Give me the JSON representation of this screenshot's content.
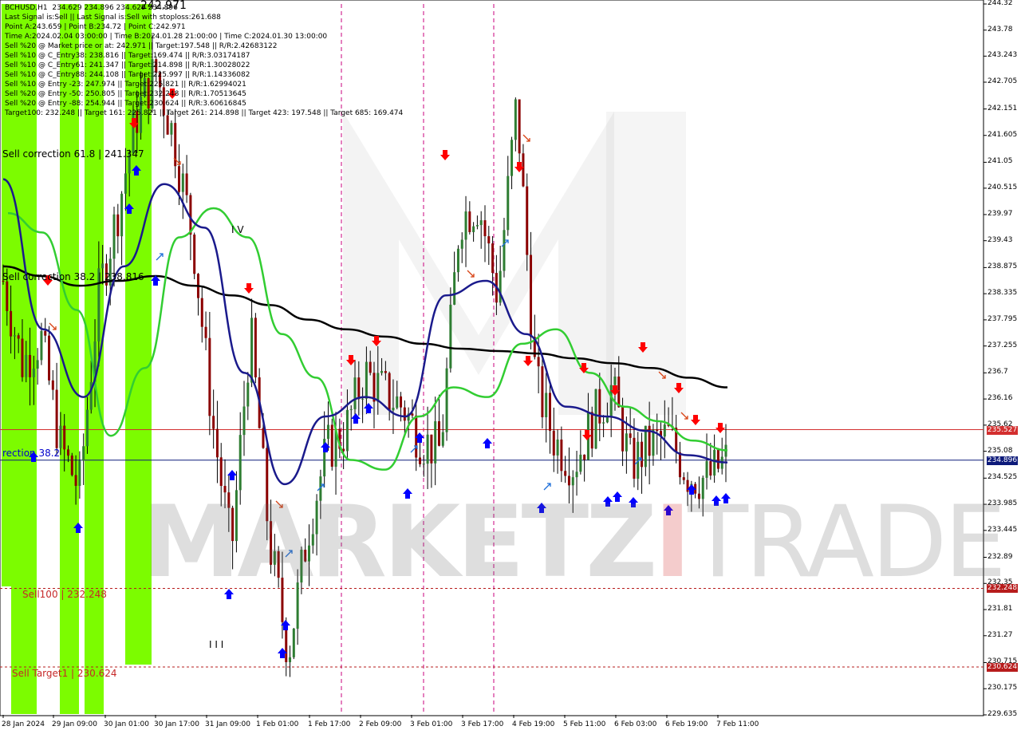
{
  "title": {
    "symbol": "BCHUSD,H1",
    "quote": "234.629 234.896 234.629 234.896"
  },
  "info_lines": [
    "Last Signal is:Sell || Last Signal is:Sell with stoploss:261.688",
    "Point A:243.659 | Point B:234.72 | Point C:242.971",
    "Time A:2024.02.04 03:00:00 | Time B:2024.01.28 21:00:00 | Time C:2024.01.30 13:00:00",
    "Sell %20 @ Market price or at: 242.971 || Target:197.548 || R/R:2.42683122",
    "Sell %10 @ C_Entry38: 238.816 || Target:169.474 || R/R:3.03174187",
    "Sell %10 @ C_Entry61: 241.347 || Target:214.898 || R/R:1.30028022",
    "Sell %10 @ C_Entry88: 244.108 || Target:225.997 || R/R:1.14336082",
    "Sell %10 @ Entry -23: 247.974 || Target:225.821 || R/R:1.62994021",
    "Sell %20 @ Entry -50: 250.805 || Target:232.248 || R/R:1.70513645",
    "Sell %20 @ Entry -88: 254.944 || Target:230.624 || R/R:3.60616845",
    "Target100: 232.248 || Target 161: 225.821 || Target 261: 214.898 || Target 423: 197.548 || Target 685: 169.474"
  ],
  "overlay_labels": {
    "correction618": "Sell correction 61.8 | 241.347",
    "correction382": "Sell correction 38.2 | 238.816",
    "correction_lower": "rection 38.2",
    "sell100": "Sell100 | 232.248",
    "sell_target1": "Sell Target1 | 230.624",
    "wave_iv": "I V",
    "wave_iii": "I I I",
    "point_c": "242.971"
  },
  "watermark": {
    "left": "MARKETZ",
    "mid": "I",
    "right": "TRADE"
  },
  "colors": {
    "green_zone": "#7cfc00",
    "ma_green": "#32cd32",
    "ma_navy": "#1a1a8c",
    "ma_black": "#000000",
    "sell_arrow": "#ff0000",
    "buy_arrow": "#0000ff",
    "target_red": "#c62828",
    "vline": "#c8007e",
    "price_tag_blue": "#0d1a7a",
    "price_tag_red": "#d32f2f",
    "price_tag_dark_red": "#b71c1c"
  },
  "chart_data": {
    "type": "candlestick",
    "symbol": "BCHUSD",
    "timeframe": "H1",
    "ylim": [
      229.635,
      244.32
    ],
    "y_ticks": [
      244.32,
      243.78,
      243.243,
      242.705,
      242.151,
      241.605,
      241.05,
      240.515,
      239.97,
      239.43,
      238.875,
      238.335,
      237.795,
      237.255,
      236.7,
      236.16,
      235.62,
      235.08,
      234.525,
      233.985,
      233.445,
      232.89,
      232.35,
      231.81,
      231.27,
      230.715,
      230.175,
      229.635
    ],
    "x_ticks": [
      "28 Jan 2024",
      "29 Jan 09:00",
      "30 Jan 01:00",
      "30 Jan 17:00",
      "31 Jan 09:00",
      "1 Feb 01:00",
      "1 Feb 17:00",
      "2 Feb 09:00",
      "3 Feb 01:00",
      "3 Feb 17:00",
      "4 Feb 19:00",
      "5 Feb 11:00",
      "6 Feb 03:00",
      "6 Feb 19:00",
      "7 Feb 11:00"
    ],
    "horizontal_levels": [
      {
        "label": "235.527",
        "value": 235.527,
        "style": "solid",
        "color": "#d32f2f"
      },
      {
        "label": "234.896",
        "value": 234.896,
        "style": "solid",
        "color": "#0d1a7a"
      },
      {
        "label": "232.248",
        "value": 232.248,
        "style": "dashed",
        "color": "#b71c1c"
      },
      {
        "label": "230.624",
        "value": 230.624,
        "style": "dashed",
        "color": "#b71c1c"
      }
    ],
    "close_series": [
      {
        "t": "28 Jan 2024",
        "v": 238.6
      },
      {
        "t": "28 Jan 12:00",
        "v": 236.9
      },
      {
        "t": "29 Jan 00:00",
        "v": 237.4
      },
      {
        "t": "29 Jan 09:00",
        "v": 235.2
      },
      {
        "t": "29 Jan 15:00",
        "v": 234.3
      },
      {
        "t": "29 Jan 21:00",
        "v": 238.3
      },
      {
        "t": "30 Jan 01:00",
        "v": 240.0
      },
      {
        "t": "30 Jan 07:00",
        "v": 242.0
      },
      {
        "t": "30 Jan 13:00",
        "v": 242.97
      },
      {
        "t": "30 Jan 17:00",
        "v": 241.5
      },
      {
        "t": "30 Jan 23:00",
        "v": 239.4
      },
      {
        "t": "31 Jan 05:00",
        "v": 235.7
      },
      {
        "t": "31 Jan 09:00",
        "v": 233.0
      },
      {
        "t": "31 Jan 15:00",
        "v": 237.6
      },
      {
        "t": "31 Jan 21:00",
        "v": 233.2
      },
      {
        "t": "1 Feb 01:00",
        "v": 230.9
      },
      {
        "t": "1 Feb 07:00",
        "v": 233.4
      },
      {
        "t": "1 Feb 13:00",
        "v": 235.1
      },
      {
        "t": "1 Feb 17:00",
        "v": 235.5
      },
      {
        "t": "1 Feb 23:00",
        "v": 236.7
      },
      {
        "t": "2 Feb 05:00",
        "v": 236.3
      },
      {
        "t": "2 Feb 09:00",
        "v": 236.0
      },
      {
        "t": "2 Feb 15:00",
        "v": 235.3
      },
      {
        "t": "2 Feb 21:00",
        "v": 235.1
      },
      {
        "t": "3 Feb 01:00",
        "v": 239.9
      },
      {
        "t": "3 Feb 07:00",
        "v": 240.2
      },
      {
        "t": "3 Feb 13:00",
        "v": 238.3
      },
      {
        "t": "3 Feb 17:00",
        "v": 242.3
      },
      {
        "t": "3 Feb 23:00",
        "v": 236.5
      },
      {
        "t": "4 Feb 07:00",
        "v": 235.3
      },
      {
        "t": "4 Feb 19:00",
        "v": 234.8
      },
      {
        "t": "5 Feb 03:00",
        "v": 235.7
      },
      {
        "t": "5 Feb 11:00",
        "v": 236.4
      },
      {
        "t": "5 Feb 19:00",
        "v": 234.8
      },
      {
        "t": "6 Feb 03:00",
        "v": 235.2
      },
      {
        "t": "6 Feb 11:00",
        "v": 235.4
      },
      {
        "t": "6 Feb 19:00",
        "v": 234.6
      },
      {
        "t": "7 Feb 03:00",
        "v": 234.5
      },
      {
        "t": "7 Feb 11:00",
        "v": 234.896
      }
    ],
    "ma_black": [
      238.9,
      238.7,
      238.5,
      238.6,
      238.7,
      238.5,
      238.3,
      238.1,
      237.8,
      237.6,
      237.45,
      237.3,
      237.2,
      237.15,
      237.1,
      237.0,
      236.9,
      236.8,
      236.6,
      236.4
    ],
    "ma_green": [
      240.0,
      239.6,
      238.0,
      235.4,
      236.8,
      239.5,
      240.1,
      239.5,
      237.5,
      236.6,
      234.9,
      234.7,
      235.8,
      236.4,
      236.2,
      237.3,
      237.6,
      236.7,
      236.0,
      235.7,
      235.3,
      235.1
    ],
    "ma_navy": [
      240.7,
      237.6,
      236.2,
      238.9,
      240.6,
      239.7,
      236.7,
      234.4,
      235.8,
      236.2,
      235.8,
      238.3,
      238.6,
      237.5,
      236.0,
      235.8,
      235.5,
      235.0,
      234.85
    ]
  }
}
